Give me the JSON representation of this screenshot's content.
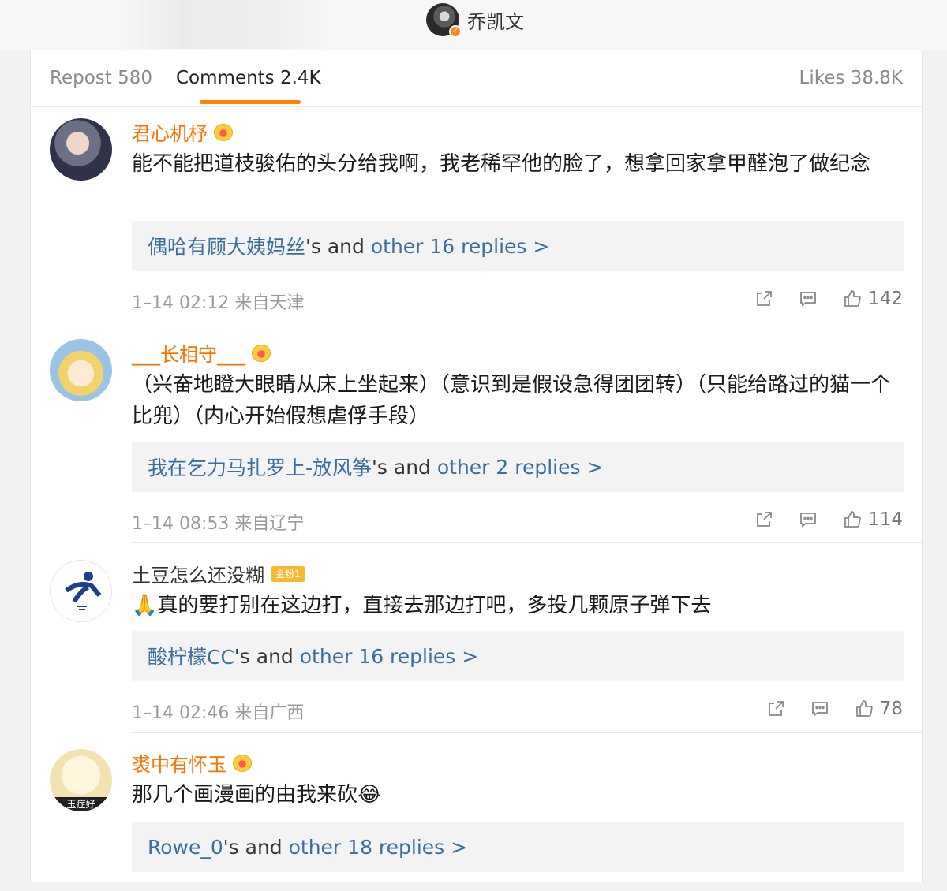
{
  "header": {
    "author_name": "乔凯文"
  },
  "tabs": {
    "repost": "Repost 580",
    "comments": "Comments 2.4K",
    "likes": "Likes 38.8K"
  },
  "comments": [
    {
      "username": "君心机杼",
      "text": "能不能把道枝骏佑的头分给我啊，我老稀罕他的脸了，想拿回家拿甲醛泡了做纪念",
      "reply_user": "偶哈有顾大姨妈丝",
      "reply_mid": "'s and ",
      "reply_more": "other 16 replies >",
      "meta": "1–14 02:12 来自天津",
      "likes": "142"
    },
    {
      "username": "___长相守___",
      "text": "（兴奋地瞪大眼睛从床上坐起来）（意识到是假设急得团团转）（只能给路过的猫一个比兜）（内心开始假想虐俘手段）",
      "reply_user": "我在乞力马扎罗上-放风筝",
      "reply_mid": "'s and ",
      "reply_more": "other 2 replies >",
      "meta": "1–14 08:53 来自辽宁",
      "likes": "114"
    },
    {
      "username": "土豆怎么还没糊",
      "badge": "金粉1",
      "text": "🙏真的要打别在这边打，直接去那边打吧，多投几颗原子弹下去",
      "reply_user": "酸柠檬CC",
      "reply_mid": "'s and ",
      "reply_more": "other 16 replies >",
      "meta": "1–14 02:46 来自广西",
      "likes": "78"
    },
    {
      "username": "裘中有怀玉",
      "text": "那几个画漫画的由我来砍😂",
      "reply_user": "Rowe_0",
      "reply_mid": "'s and ",
      "reply_more": "other 18 replies >",
      "avatar_text": "玉症好"
    }
  ],
  "colors": {
    "accent": "#ff8200",
    "username": "#ff7000",
    "link_blue": "#3a6e9f"
  },
  "icons": [
    "share-icon",
    "comment-icon",
    "like-icon",
    "crown-icon",
    "verified-icon"
  ]
}
